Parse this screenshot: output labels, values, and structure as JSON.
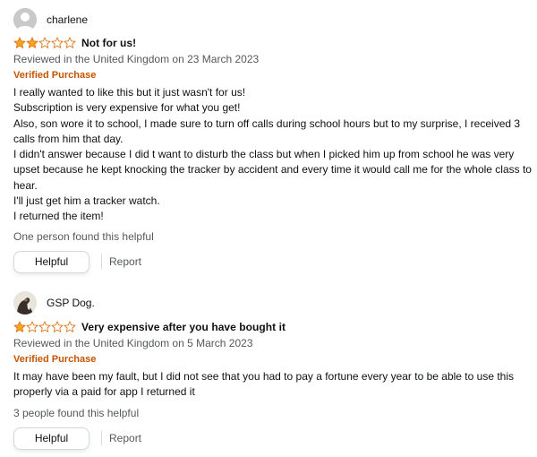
{
  "reviews": [
    {
      "profile_name": "charlene",
      "avatar": "default-avatar",
      "rating": 2,
      "max_rating": 5,
      "title": "Not for us!",
      "date_line": "Reviewed in the United Kingdom on 23 March 2023",
      "verified": "Verified Purchase",
      "body": [
        "I really wanted to like this but it just wasn't for us!",
        "Subscription is very expensive for what you get!",
        "Also, son wore it to school, I made sure to turn off calls during school hours but to my surprise, I received 3 calls from him that day.",
        "I didn't answer because I did t want to disturb the class but when I picked him up from school he was very upset because he kept knocking the tracker by accident and every time it would call me for the whole class to hear.",
        "I'll just get him a tracker watch.",
        "I returned the item!"
      ],
      "helpful_count": "One person found this helpful",
      "helpful_label": "Helpful",
      "report_label": "Report"
    },
    {
      "profile_name": "GSP Dog.",
      "avatar": "photo-avatar",
      "rating": 1,
      "max_rating": 5,
      "title": "Very expensive after you have bought it",
      "date_line": "Reviewed in the United Kingdom on 5 March 2023",
      "verified": "Verified Purchase",
      "body": [
        "It may have been my fault, but I did not see that you had to pay a fortune every year to be able to use this properly via a paid for app I returned it"
      ],
      "helpful_count": "3 people found this helpful",
      "helpful_label": "Helpful",
      "report_label": "Report"
    }
  ],
  "colors": {
    "star_fill": "#f9a41b",
    "star_outline": "#de7921",
    "verified": "#c45500",
    "muted": "#565959"
  },
  "icons": {
    "star_filled": "star-filled-icon",
    "star_empty": "star-empty-icon"
  }
}
